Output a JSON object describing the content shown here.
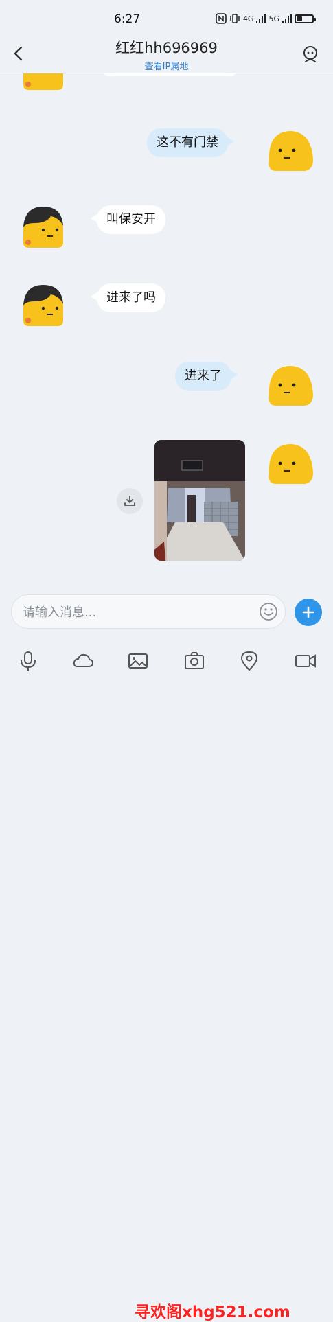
{
  "status": {
    "time": "6:27",
    "net_4g": "4G",
    "net_5g": "5G",
    "battery_percent": 38
  },
  "header": {
    "title": "红红hh696969",
    "subtitle": "查看IP属地"
  },
  "messages": [
    {
      "from": "me",
      "text": "这不有门禁"
    },
    {
      "from": "them",
      "text": "叫保安开"
    },
    {
      "from": "them",
      "text": "进来了吗"
    },
    {
      "from": "me",
      "text": "进来了"
    },
    {
      "from": "me",
      "type": "image",
      "caption": "走廊照片"
    }
  ],
  "input": {
    "placeholder": "请输入消息..."
  },
  "watermark": "寻欢阁xhg521.com",
  "colors": {
    "accent": "#2f95e8",
    "my_bubble": "#d7ebfb",
    "background": "#eef1f6"
  },
  "icons": [
    "back-arrow-icon",
    "profile-icon",
    "download-icon",
    "emoji-icon",
    "plus-icon",
    "microphone-icon",
    "cloud-icon",
    "image-icon",
    "camera-icon",
    "location-icon",
    "video-icon"
  ]
}
